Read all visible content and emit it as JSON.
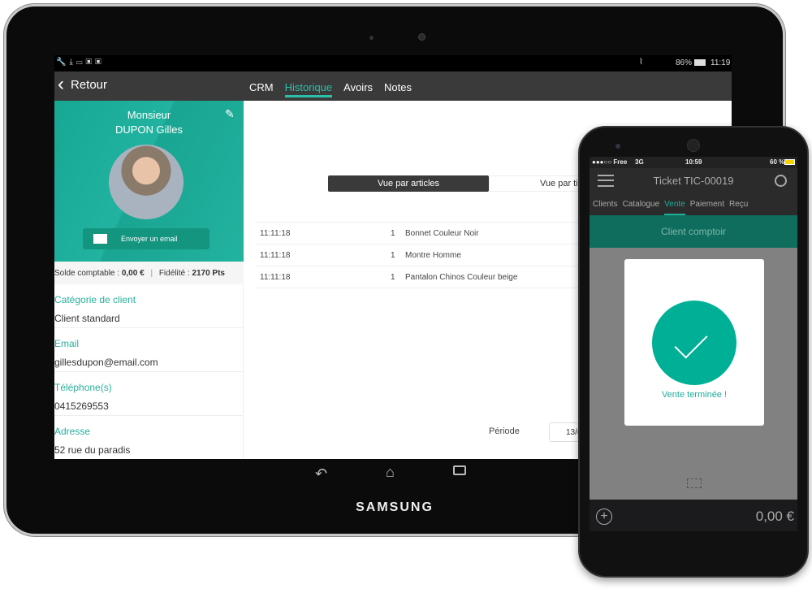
{
  "tablet": {
    "brand": "SAMSUNG",
    "status": {
      "battery": "86%",
      "time": "11:19"
    },
    "header": {
      "back_label": "Retour"
    },
    "customer": {
      "title": "Monsieur",
      "name": "DUPON Gilles",
      "email_button": "Envoyer un email",
      "balance_label": "Solde comptable :",
      "balance_value": "0,00 €",
      "separator": "|",
      "loyalty_label": "Fidélité :",
      "loyalty_value": "2170 Pts"
    },
    "fields": [
      {
        "label": "Catégorie de client",
        "value": "Client standard"
      },
      {
        "label": "Email",
        "value": "gillesdupon@email.com"
      },
      {
        "label": "Téléphone(s)",
        "value": "0415269553"
      },
      {
        "label": "Adresse",
        "value": "52 rue du paradis"
      }
    ],
    "tabs": [
      {
        "label": "CRM"
      },
      {
        "label": "Historique",
        "active": true
      },
      {
        "label": "Avoirs"
      },
      {
        "label": "Notes"
      }
    ],
    "view_toggle": {
      "active": "Vue par articles",
      "other": "Vue par ti"
    },
    "rows": [
      {
        "time": "11:11:18",
        "qty": "1",
        "item": "Bonnet Couleur Noir"
      },
      {
        "time": "11:11:18",
        "qty": "1",
        "item": "Montre Homme"
      },
      {
        "time": "11:11:18",
        "qty": "1",
        "item": "Pantalon Chinos Couleur beige"
      }
    ],
    "period": {
      "label": "Période",
      "value": "13/("
    }
  },
  "phone": {
    "status": {
      "carrier": "●●●○○ Free",
      "network": "3G",
      "time": "10:59",
      "battery": "60 %"
    },
    "title": "Ticket TIC-00019",
    "tabs": [
      {
        "label": "Clients"
      },
      {
        "label": "Catalogue"
      },
      {
        "label": "Vente",
        "active": true
      },
      {
        "label": "Paiement"
      },
      {
        "label": "Reçu"
      }
    ],
    "customer_bar": "Client comptoir",
    "success_message": "Vente terminée !",
    "total": "0,00 €"
  },
  "colors": {
    "accent": "#1fae9b",
    "dark": "#3a3a3a",
    "phone_bar": "#0e6d5d"
  }
}
